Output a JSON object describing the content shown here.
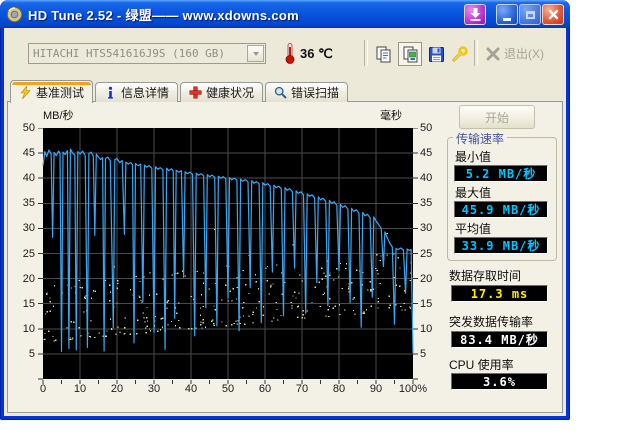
{
  "window": {
    "title": "HD Tune 2.52 - 绿盟—— www.xdowns.com",
    "controls": [
      "download",
      "minimize",
      "maximize",
      "close"
    ]
  },
  "toolbar": {
    "drive_select": "HITACHI HTS541616J9S (160 GB)",
    "temperature": "36 ℃",
    "buttons": [
      "copy",
      "copy-image",
      "save",
      "options"
    ],
    "exit_label": "退出(X)"
  },
  "tabs": [
    {
      "label": "基准测试",
      "icon": "lightning-icon",
      "active": true
    },
    {
      "label": "信息详情",
      "icon": "info-icon",
      "active": false
    },
    {
      "label": "健康状况",
      "icon": "health-cross-icon",
      "active": false
    },
    {
      "label": "错误扫描",
      "icon": "magnifier-icon",
      "active": false
    }
  ],
  "panel": {
    "start_label": "开始",
    "group": {
      "title": "传输速率",
      "fields": [
        {
          "label": "最小值",
          "value": "5.2 MB/秒",
          "color": "#00c6ff"
        },
        {
          "label": "最大值",
          "value": "45.9 MB/秒",
          "color": "#00c6ff"
        },
        {
          "label": "平均值",
          "value": "33.9 MB/秒",
          "color": "#00c6ff"
        }
      ]
    },
    "fields": [
      {
        "label": "数据存取时间",
        "value": "17.3 ms",
        "color": "#ffee00"
      },
      {
        "label": "突发数据传输率",
        "value": "83.4 MB/秒",
        "color": "#ffffff"
      },
      {
        "label": "CPU 使用率",
        "value": "3.6%",
        "color": "#ffffff"
      }
    ]
  },
  "chart_data": {
    "type": "line+scatter",
    "left_axis_label": "MB/秒",
    "right_axis_label": "毫秒",
    "xlim": [
      0,
      100
    ],
    "ylim": [
      0,
      50
    ],
    "x_ticks": [
      "0",
      "10",
      "20",
      "30",
      "40",
      "50",
      "60",
      "70",
      "80",
      "90",
      "100%"
    ],
    "y_ticks_left": [
      "50",
      "45",
      "40",
      "35",
      "30",
      "25",
      "20",
      "15",
      "10",
      "5"
    ],
    "y_ticks_right": [
      "50",
      "45",
      "40",
      "35",
      "30",
      "25",
      "20",
      "15",
      "10",
      "5"
    ],
    "grid": true,
    "plot_bg": "#000000",
    "grid_color": "#4b4b4b",
    "line_color": "#3da6f2",
    "scatter_color": "#d9e092",
    "line_series_name": "transfer_rate_mb_per_s",
    "line_stats": {
      "min": 5.2,
      "max": 45.9,
      "avg": 33.9
    },
    "line_points": [
      [
        0,
        42.5
      ],
      [
        0.5,
        45.3
      ],
      [
        1,
        44.3
      ],
      [
        1.6,
        45.6
      ],
      [
        2.2,
        44.9
      ],
      [
        2.6,
        28.2
      ],
      [
        3,
        45.1
      ],
      [
        3.6,
        44.5
      ],
      [
        4.2,
        45.4
      ],
      [
        4.6,
        45
      ],
      [
        5,
        5.5
      ],
      [
        5.4,
        45.2
      ],
      [
        6,
        44.7
      ],
      [
        6.6,
        45.5
      ],
      [
        7,
        6.1
      ],
      [
        7.4,
        45.8
      ],
      [
        8,
        45
      ],
      [
        8.6,
        44.6
      ],
      [
        9,
        5.8
      ],
      [
        9.4,
        45.3
      ],
      [
        10,
        44.8
      ],
      [
        10.7,
        45.4
      ],
      [
        11.4,
        44.5
      ],
      [
        12,
        6.3
      ],
      [
        12.4,
        44.9
      ],
      [
        13,
        45.2
      ],
      [
        13.6,
        44.4
      ],
      [
        14,
        28.6
      ],
      [
        14.4,
        44.8
      ],
      [
        15,
        44.2
      ],
      [
        15.6,
        43.7
      ],
      [
        16.1,
        44.1
      ],
      [
        16.5,
        5.6
      ],
      [
        16.9,
        43.9
      ],
      [
        17.5,
        44.2
      ],
      [
        18.2,
        43.5
      ],
      [
        19,
        10.2
      ],
      [
        19.4,
        43.7
      ],
      [
        20,
        43.9
      ],
      [
        20.7,
        43.1
      ],
      [
        21.4,
        43.5
      ],
      [
        22,
        28.8
      ],
      [
        22.4,
        43.2
      ],
      [
        23,
        42.8
      ],
      [
        23.7,
        43.1
      ],
      [
        24.2,
        42.7
      ],
      [
        24.6,
        7.2
      ],
      [
        25,
        42.9
      ],
      [
        25.7,
        42.5
      ],
      [
        26.4,
        42.8
      ],
      [
        27,
        15.4
      ],
      [
        27.4,
        42.6
      ],
      [
        28,
        42.2
      ],
      [
        28.7,
        42.5
      ],
      [
        29.4,
        42
      ],
      [
        30,
        9.3
      ],
      [
        30.4,
        42.3
      ],
      [
        31,
        41.8
      ],
      [
        31.7,
        42.1
      ],
      [
        32.4,
        41.7
      ],
      [
        33,
        5.9
      ],
      [
        33.4,
        42
      ],
      [
        34,
        41.5
      ],
      [
        34.7,
        41.9
      ],
      [
        35.2,
        41.4
      ],
      [
        35.6,
        12.1
      ],
      [
        36,
        41.6
      ],
      [
        36.7,
        41.2
      ],
      [
        37.4,
        41.5
      ],
      [
        38,
        20.3
      ],
      [
        38.4,
        41.3
      ],
      [
        39,
        40.9
      ],
      [
        39.7,
        41.2
      ],
      [
        40.4,
        40.8
      ],
      [
        41,
        8.6
      ],
      [
        41.4,
        41
      ],
      [
        42,
        40.6
      ],
      [
        42.7,
        40.9
      ],
      [
        43.4,
        40.5
      ],
      [
        44,
        14.2
      ],
      [
        44.4,
        40.7
      ],
      [
        45,
        40.3
      ],
      [
        45.7,
        40.6
      ],
      [
        46.4,
        40.2
      ],
      [
        47,
        10.6
      ],
      [
        47.4,
        40.4
      ],
      [
        48,
        40
      ],
      [
        48.7,
        40.3
      ],
      [
        49.4,
        39.9
      ],
      [
        50,
        16.1
      ],
      [
        50.4,
        40.1
      ],
      [
        51,
        39.7
      ],
      [
        51.7,
        40
      ],
      [
        52.4,
        39.6
      ],
      [
        53,
        9.6
      ],
      [
        53.4,
        39.8
      ],
      [
        54,
        39.4
      ],
      [
        54.7,
        39.7
      ],
      [
        55.4,
        39.3
      ],
      [
        56,
        18.2
      ],
      [
        56.4,
        39.5
      ],
      [
        57,
        39
      ],
      [
        57.7,
        39.3
      ],
      [
        58.4,
        38.9
      ],
      [
        59,
        11.2
      ],
      [
        59.4,
        39.1
      ],
      [
        60,
        38.6
      ],
      [
        60.7,
        38.9
      ],
      [
        61.4,
        38.4
      ],
      [
        62,
        21.3
      ],
      [
        62.4,
        38.6
      ],
      [
        63,
        38.1
      ],
      [
        63.7,
        38.4
      ],
      [
        64.4,
        37.9
      ],
      [
        65,
        12.6
      ],
      [
        65.4,
        38.1
      ],
      [
        66,
        37.6
      ],
      [
        66.7,
        37.9
      ],
      [
        67.4,
        37.3
      ],
      [
        68,
        22.1
      ],
      [
        68.4,
        37.5
      ],
      [
        69,
        37
      ],
      [
        69.7,
        37.3
      ],
      [
        70.4,
        36.7
      ],
      [
        71,
        13.1
      ],
      [
        71.4,
        36.9
      ],
      [
        72,
        36.4
      ],
      [
        72.7,
        36.7
      ],
      [
        73.4,
        36.1
      ],
      [
        74,
        19.2
      ],
      [
        74.4,
        36.3
      ],
      [
        75,
        35.7
      ],
      [
        75.7,
        36
      ],
      [
        76.4,
        35.4
      ],
      [
        77,
        14.6
      ],
      [
        77.4,
        35.6
      ],
      [
        78,
        35
      ],
      [
        78.7,
        35.3
      ],
      [
        79.4,
        34.6
      ],
      [
        80,
        21.6
      ],
      [
        80.4,
        34.8
      ],
      [
        81,
        34.2
      ],
      [
        81.7,
        34.5
      ],
      [
        82.4,
        33.8
      ],
      [
        83,
        15.2
      ],
      [
        83.4,
        34
      ],
      [
        84,
        33.4
      ],
      [
        84.7,
        33.7
      ],
      [
        85.4,
        33
      ],
      [
        86,
        10.3
      ],
      [
        86.4,
        33.2
      ],
      [
        87,
        32.5
      ],
      [
        87.7,
        32.8
      ],
      [
        88.4,
        32.1
      ],
      [
        89,
        16.3
      ],
      [
        89.4,
        32.3
      ],
      [
        90,
        31.5
      ],
      [
        90.7,
        30.8
      ],
      [
        91.4,
        30
      ],
      [
        92,
        22.4
      ],
      [
        92.4,
        29.3
      ],
      [
        93,
        28.2
      ],
      [
        93.7,
        27.1
      ],
      [
        94.4,
        26.3
      ],
      [
        95,
        10.9
      ],
      [
        95.4,
        26
      ],
      [
        96,
        25.8
      ],
      [
        96.7,
        26.1
      ],
      [
        97.4,
        25.7
      ],
      [
        98,
        17.1
      ],
      [
        98.4,
        25.9
      ],
      [
        99,
        25.6
      ],
      [
        99.5,
        25.8
      ],
      [
        100,
        5.2
      ]
    ],
    "scatter": {
      "name": "access_time_ms",
      "count": 330,
      "seed": 42,
      "y_base": 7.5,
      "y_spread": 12,
      "x_trend": 0.065
    }
  }
}
